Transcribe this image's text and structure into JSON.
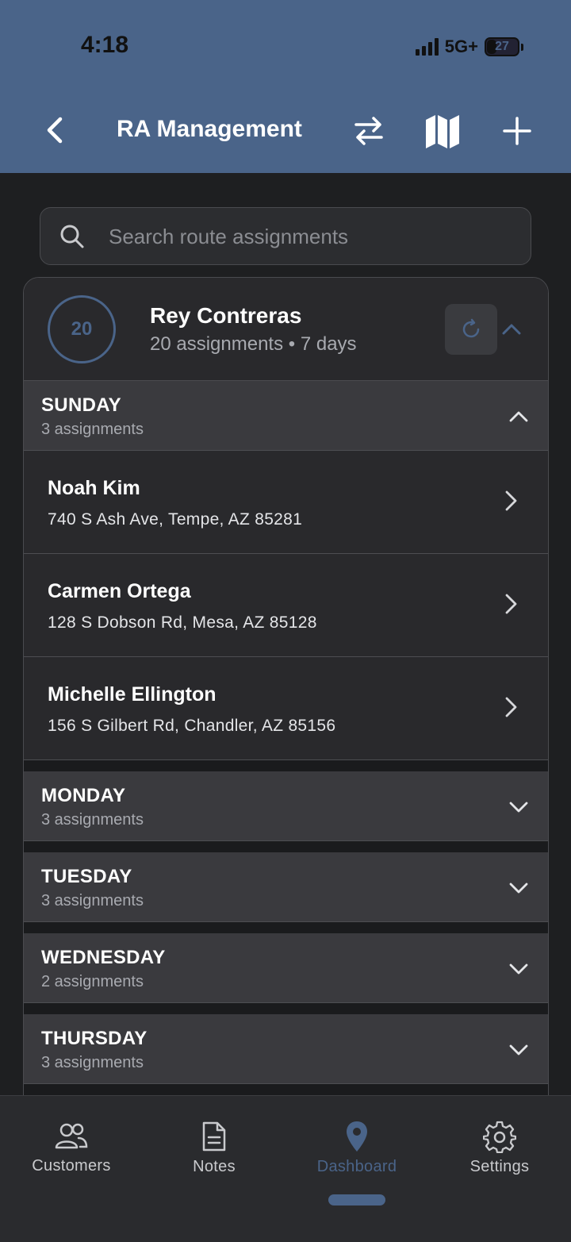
{
  "status_bar": {
    "time": "4:18",
    "network": "5G+",
    "battery": "27"
  },
  "toolbar": {
    "title": "RA Management",
    "back_icon": "chevron-left-icon",
    "swap_icon": "swap-arrows-icon",
    "map_icon": "map-icon",
    "add_icon": "plus-icon"
  },
  "search": {
    "placeholder": "Search route assignments",
    "value": ""
  },
  "assignee": {
    "avatar_count": "20",
    "name": "Rey Contreras",
    "summary": "20 assignments • 7 days"
  },
  "days": [
    {
      "name": "SUNDAY",
      "count": "3 assignments",
      "expanded": true,
      "items": [
        {
          "name": "Noah Kim",
          "address": "740 S Ash Ave, Tempe, AZ 85281"
        },
        {
          "name": "Carmen Ortega",
          "address": "128 S Dobson Rd, Mesa, AZ 85128"
        },
        {
          "name": "Michelle Ellington",
          "address": "156 S Gilbert Rd, Chandler, AZ 85156"
        }
      ]
    },
    {
      "name": "MONDAY",
      "count": "3 assignments",
      "expanded": false
    },
    {
      "name": "TUESDAY",
      "count": "3 assignments",
      "expanded": false
    },
    {
      "name": "WEDNESDAY",
      "count": "2 assignments",
      "expanded": false
    },
    {
      "name": "THURSDAY",
      "count": "3 assignments",
      "expanded": false
    }
  ],
  "bottom_nav": [
    {
      "label": "Customers",
      "icon": "users-icon",
      "active": false
    },
    {
      "label": "Notes",
      "icon": "document-icon",
      "active": false
    },
    {
      "label": "Dashboard",
      "icon": "map-pin-icon",
      "active": true
    },
    {
      "label": "Settings",
      "icon": "gear-icon",
      "active": false
    }
  ],
  "colors": {
    "header": "#4a6489",
    "accent": "#4a6489",
    "background": "#1e1f21",
    "card": "#29292c",
    "day_header": "#3a3a3e"
  }
}
